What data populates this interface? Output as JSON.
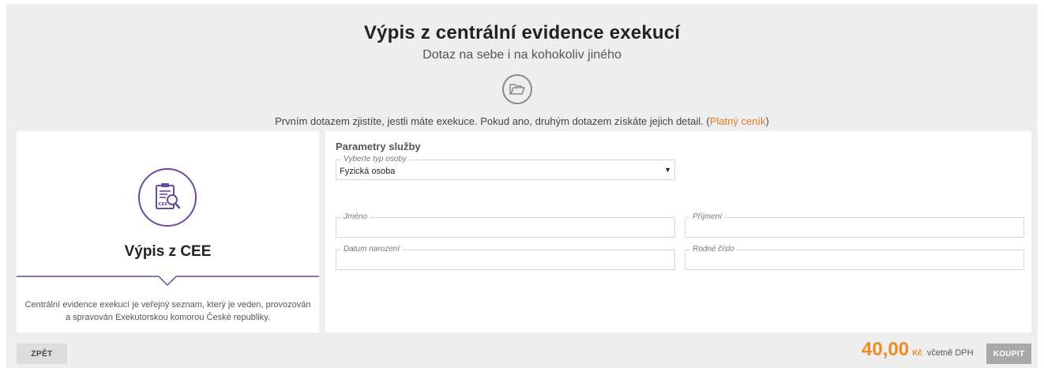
{
  "header": {
    "title": "Výpis z centrální evidence exekucí",
    "subtitle": "Dotaz na sebe i na kohokoliv jiného",
    "folder_icon": "folder-open-icon",
    "info_text": "Prvním dotazem zjistíte, jestli máte exekuce. Pokud ano, druhým dotazem získáte jejich detail. (",
    "info_link": "Platný ceník",
    "info_suffix": ")"
  },
  "product": {
    "icon": "clipboard-search-icon",
    "icon_label": "CEE",
    "name": "Výpis z CEE",
    "description": "Centrální evidence exekucí je veřejný seznam, který je veden, provozován a spravován Exekutorskou komorou České republiky."
  },
  "form": {
    "section_title": "Parametry služby",
    "person_type": {
      "label": "Vyberte typ osoby",
      "value": "Fyzická osoba"
    },
    "first_name": {
      "label": "Jméno",
      "value": ""
    },
    "last_name": {
      "label": "Příjmení",
      "value": ""
    },
    "birth_date": {
      "label": "Datum narození",
      "value": ""
    },
    "birth_number": {
      "label": "Rodné číslo",
      "value": ""
    }
  },
  "footer": {
    "back_label": "ZPĚT",
    "price": "40,00",
    "currency": "Kč",
    "vat_note": "včetně DPH",
    "buy_label": "KOUPIT"
  },
  "colors": {
    "accent_orange": "#f08a24",
    "accent_purple": "#6b4a9b",
    "background": "#eeeeee"
  }
}
